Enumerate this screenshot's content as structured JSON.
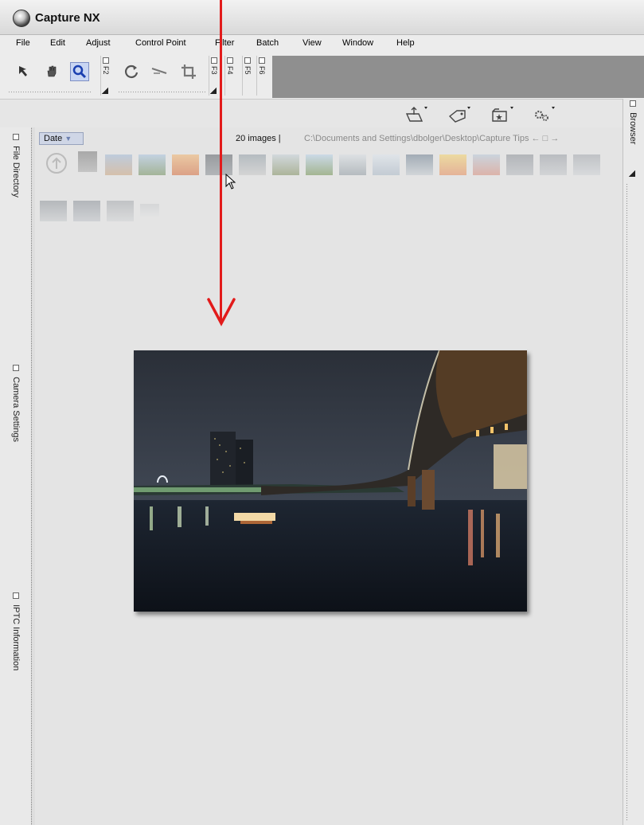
{
  "app": {
    "title": "Capture NX"
  },
  "menu": [
    "File",
    "Edit",
    "Adjust",
    "Control Point",
    "Filter",
    "Batch",
    "View",
    "Window",
    "Help"
  ],
  "toolbar": {
    "tools": [
      "arrow-tool",
      "hand-tool",
      "zoom-tool",
      "rotate-tool",
      "straighten-tool",
      "crop-tool"
    ],
    "active_tool": "zoom-tool",
    "function_tabs": [
      "F2",
      "F3",
      "F4",
      "F5",
      "F6"
    ]
  },
  "browser_toolbar": {
    "icons": [
      "open-folder-icon",
      "label-tag-icon",
      "folder-star-icon",
      "settings-gears-icon"
    ]
  },
  "side_panels": {
    "left": [
      "File Directory",
      "Camera Settings",
      "IPTC Information"
    ],
    "right": [
      "Browser"
    ]
  },
  "browser": {
    "sort_label": "Date",
    "image_count": "20 images |",
    "path": "C:\\Documents and Settings\\dbolger\\Desktop\\Capture Tips",
    "thumbnail_count": 20
  },
  "colors": {
    "annotation_arrow": "#e21b1b",
    "active_tool": "#c9d6f3",
    "toolbar_fill": "#8f8f8f"
  }
}
